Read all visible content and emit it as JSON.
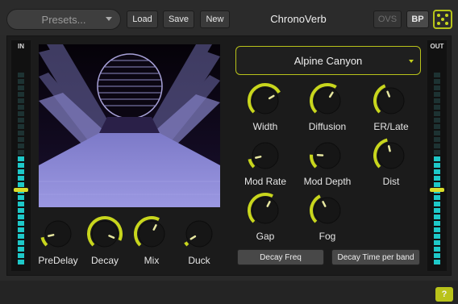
{
  "header": {
    "presets_label": "Presets...",
    "load_label": "Load",
    "save_label": "Save",
    "new_label": "New",
    "plugin_title": "ChronoVerb",
    "ovs_label": "OVS",
    "bp_label": "BP",
    "dice_icon": "dice-icon"
  },
  "meters": {
    "in_label": "IN",
    "out_label": "OUT",
    "in_level": 0.55,
    "out_level": 0.55
  },
  "preset_selector": {
    "value": "Alpine Canyon"
  },
  "knobs_left": [
    {
      "name": "predelay",
      "label": "PreDelay",
      "value": 0.12
    },
    {
      "name": "decay",
      "label": "Decay",
      "value": 0.92
    },
    {
      "name": "mix",
      "label": "Mix",
      "value": 0.6
    },
    {
      "name": "duck",
      "label": "Duck",
      "value": 0.05
    }
  ],
  "knobs_right": [
    {
      "name": "width",
      "label": "Width",
      "value": 0.72
    },
    {
      "name": "diffusion",
      "label": "Diffusion",
      "value": 0.62
    },
    {
      "name": "er-late",
      "label": "ER/Late",
      "value": 0.42
    },
    {
      "name": "mod-rate",
      "label": "Mod Rate",
      "value": 0.12
    },
    {
      "name": "mod-depth",
      "label": "Mod Depth",
      "value": 0.18
    },
    {
      "name": "dist",
      "label": "Dist",
      "value": 0.45
    },
    {
      "name": "gap",
      "label": "Gap",
      "value": 0.6
    },
    {
      "name": "fog",
      "label": "Fog",
      "value": 0.4
    }
  ],
  "buttons": {
    "decay_freq": "Decay Freq",
    "decay_time_per_band": "Decay Time per band"
  },
  "help_label": "?",
  "colors": {
    "accent": "#c8d61d",
    "meter": "#1ec8c8",
    "viz_floor": "#8a87d4"
  }
}
